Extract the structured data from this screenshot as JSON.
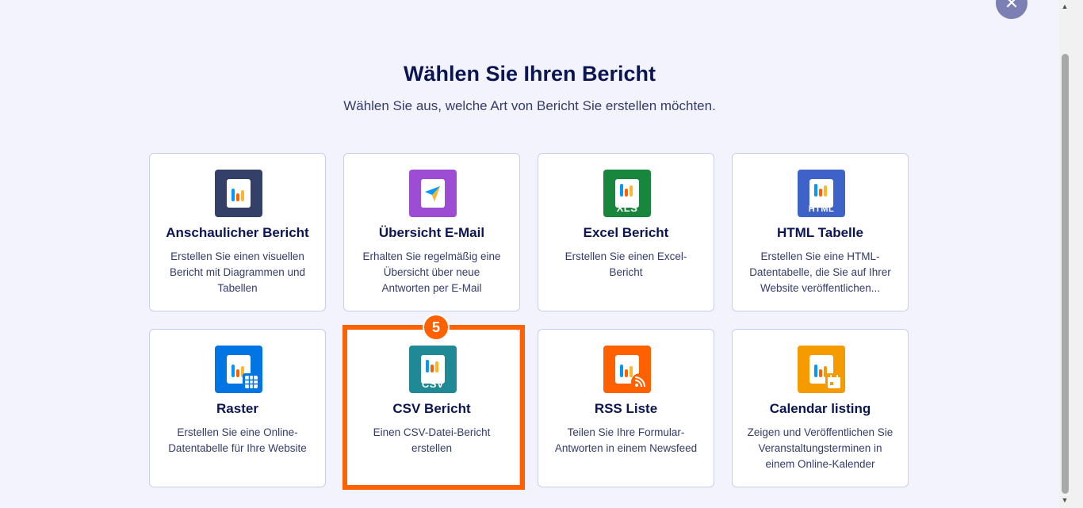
{
  "header": {
    "title": "Wählen Sie Ihren Bericht",
    "subtitle": "Wählen Sie aus, welche Art von Bericht Sie erstellen möchten."
  },
  "close_label": "✕",
  "cards": [
    {
      "title": "Anschaulicher Bericht",
      "desc": "Erstellen Sie einen visuellen Bericht mit Diagrammen und Tabellen",
      "icon": "visual-report-icon",
      "color": "#344067"
    },
    {
      "title": "Übersicht E-Mail",
      "desc": "Erhalten Sie regelmäßig eine Übersicht über neue Antworten per E-Mail",
      "icon": "email-digest-icon",
      "color": "#9c4dd3"
    },
    {
      "title": "Excel Bericht",
      "desc": "Erstellen Sie einen Excel-Bericht",
      "icon": "excel-report-icon",
      "color": "#18873d",
      "tag": "XLS"
    },
    {
      "title": "HTML Tabelle",
      "desc": "Erstellen Sie eine HTML-Datentabelle, die Sie auf Ihrer Website veröffentlichen...",
      "icon": "html-table-icon",
      "color": "#3e62c8",
      "tag": "HTML"
    },
    {
      "title": "Raster",
      "desc": "Erstellen Sie eine Online-Datentabelle für Ihre Website",
      "icon": "grid-report-icon",
      "color": "#0075e3"
    },
    {
      "title": "CSV Bericht",
      "desc": "Einen CSV-Datei-Bericht erstellen",
      "icon": "csv-report-icon",
      "color": "#1f8a96",
      "tag": "CSV"
    },
    {
      "title": "RSS Liste",
      "desc": "Teilen Sie Ihre Formular-Antworten in einem Newsfeed",
      "icon": "rss-feed-icon",
      "color": "#ff6100"
    },
    {
      "title": "Calendar listing",
      "desc": "Zeigen und Veröffentlichen Sie Veranstaltungsterminen in einem Online-Kalender",
      "icon": "calendar-listing-icon",
      "color": "#f59b00"
    }
  ],
  "step_badge": "5"
}
